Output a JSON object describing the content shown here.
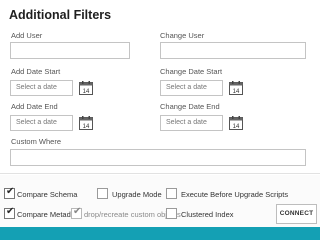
{
  "panel": {
    "title": "Additional Filters",
    "add_user_label": "Add User",
    "change_user_label": "Change User",
    "add_date_start_label": "Add Date Start",
    "change_date_start_label": "Change Date Start",
    "add_date_end_label": "Add Date End",
    "change_date_end_label": "Change Date End",
    "custom_where_label": "Custom Where",
    "date_placeholder": "Select a date",
    "calendar_day": "14"
  },
  "options": {
    "compare_schema": {
      "label": "Compare Schema",
      "checked": true
    },
    "upgrade_mode": {
      "label": "Upgrade Mode",
      "checked": false
    },
    "execute_before": {
      "label": "Execute Before Upgrade Scripts",
      "checked": false
    },
    "compare_metadata": {
      "label": "Compare Metadata",
      "checked": true
    },
    "drop_recreate": {
      "label": "drop/recreate custom objects",
      "checked": true,
      "disabled": true
    },
    "clustered_index": {
      "label": "Clustered Index",
      "checked": false
    }
  },
  "connect_label": "CONNECT",
  "colors": {
    "footer": "#14a0b4"
  }
}
